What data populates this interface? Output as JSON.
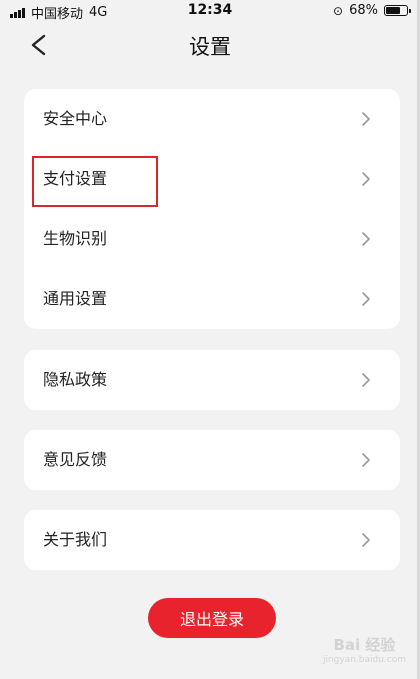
{
  "status_bar": {
    "carrier": "中国移动",
    "network": "4G",
    "time": "12:34",
    "battery": "68%",
    "battery_level": 0.68
  },
  "nav": {
    "title": "设置",
    "back_icon": "chevron-left-icon"
  },
  "groups": [
    {
      "items": [
        {
          "label": "安全中心"
        },
        {
          "label": "支付设置"
        },
        {
          "label": "生物识别"
        },
        {
          "label": "通用设置"
        }
      ]
    },
    {
      "items": [
        {
          "label": "隐私政策"
        }
      ]
    },
    {
      "items": [
        {
          "label": "意见反馈"
        }
      ]
    },
    {
      "items": [
        {
          "label": "关于我们"
        }
      ]
    }
  ],
  "highlighted_item": "支付设置",
  "logout_label": "退出登录",
  "watermark": {
    "main": "Bai 经验",
    "sub": "jingyan.baidu.com"
  },
  "colors": {
    "accent": "#e8232d",
    "highlight": "#d8252e",
    "background": "#f2f2f2",
    "card": "#ffffff"
  }
}
